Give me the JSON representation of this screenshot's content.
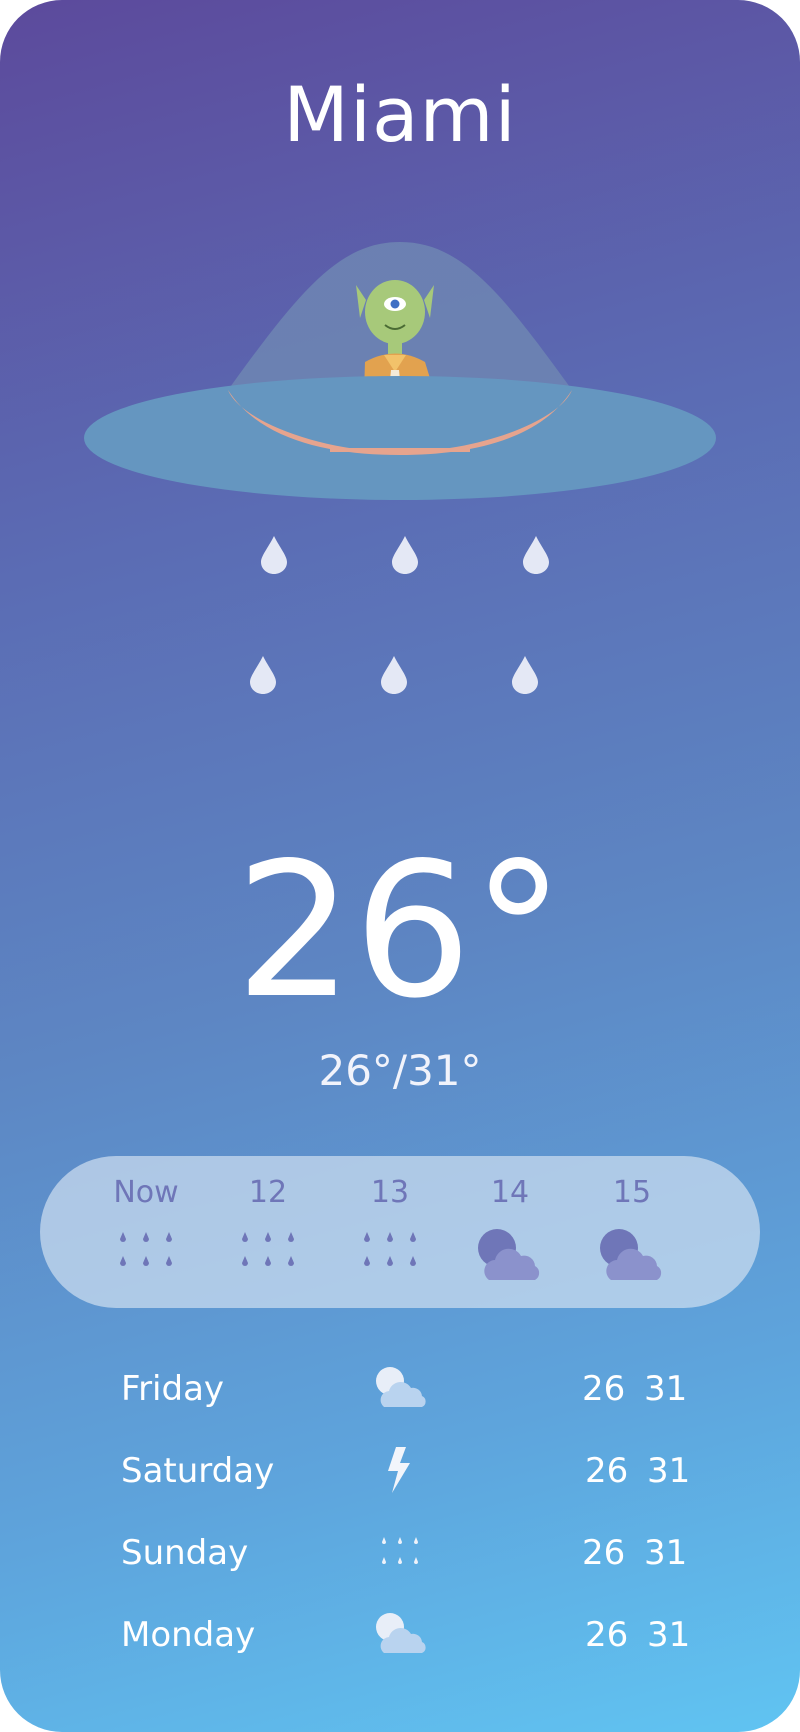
{
  "location": {
    "city": "Miami"
  },
  "current": {
    "temperature": "26°",
    "range": "26°/31°",
    "condition_icon": "rain-icon"
  },
  "hourly": [
    {
      "label": "Now",
      "icon": "rain-icon"
    },
    {
      "label": "12",
      "icon": "rain-icon"
    },
    {
      "label": "13",
      "icon": "rain-icon"
    },
    {
      "label": "14",
      "icon": "partly-cloudy-night-icon"
    },
    {
      "label": "15",
      "icon": "partly-cloudy-night-icon"
    }
  ],
  "daily": [
    {
      "day": "Friday",
      "icon": "partly-cloudy-icon",
      "low": "26",
      "high": "31"
    },
    {
      "day": "Saturday",
      "icon": "lightning-icon",
      "low": "26",
      "high": "31"
    },
    {
      "day": "Sunday",
      "icon": "drizzle-icon",
      "low": "26",
      "high": "31"
    },
    {
      "day": "Monday",
      "icon": "partly-cloudy-icon",
      "low": "26",
      "high": "31"
    }
  ],
  "colors": {
    "gradient_top": "#5c4a9c",
    "gradient_bottom": "#60c4f2",
    "hourly_panel": "#cddef0",
    "hourly_text": "#6f76b8",
    "alien_skin": "#a7c97a",
    "alien_shirt": "#e2a24f",
    "ufo_body": "#6596c0"
  }
}
